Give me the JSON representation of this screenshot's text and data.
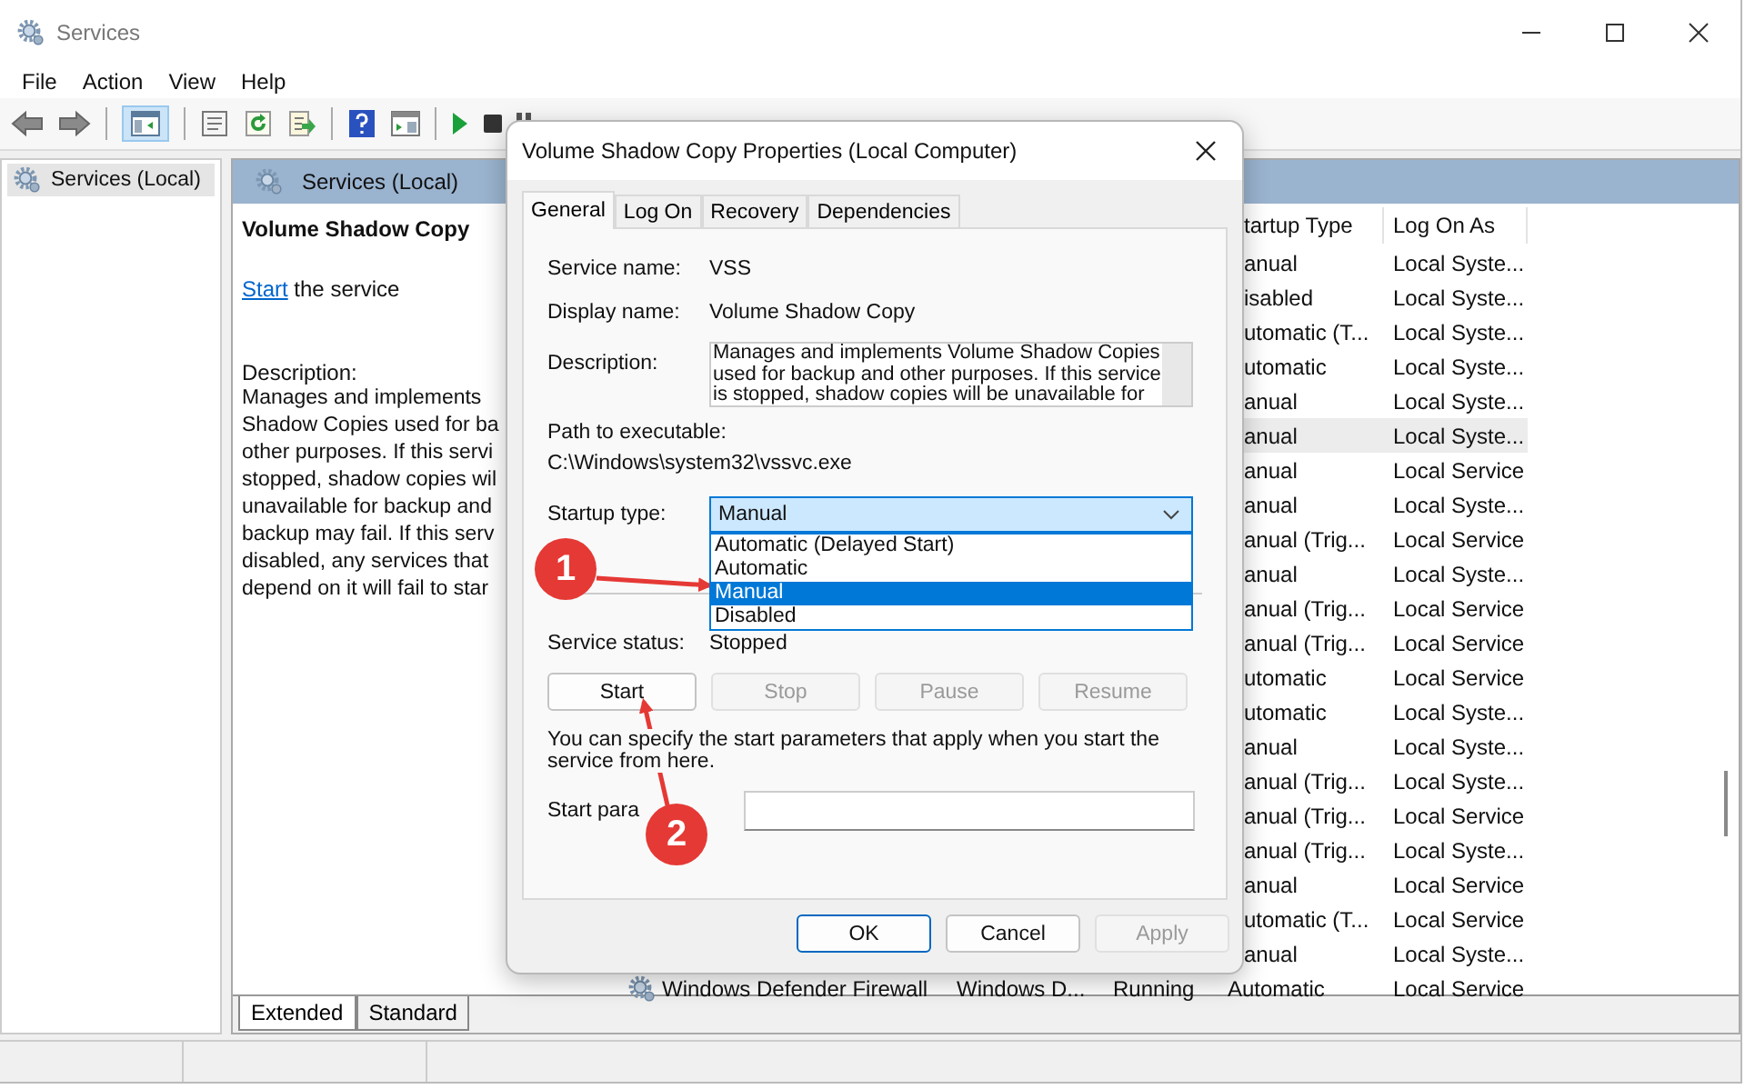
{
  "window": {
    "title": "Services"
  },
  "menu": [
    "File",
    "Action",
    "View",
    "Help"
  ],
  "toolbar": {
    "console_tree_pressed": true
  },
  "tree": [
    {
      "label": "Services (Local)",
      "selected": true
    }
  ],
  "pane": {
    "header": "Services (Local)",
    "service_title": "Volume Shadow Copy",
    "action_link": "Start",
    "action_rest": " the service",
    "description_label": "Description:",
    "description_lines": [
      "Manages and implements",
      "Shadow Copies used for ba",
      "other purposes. If this servi",
      "stopped, shadow copies wil",
      "unavailable for backup and",
      "backup may fail. If this serv",
      "disabled, any services that",
      "depend on it will fail to star"
    ]
  },
  "list": {
    "columns": [
      "tartup Type",
      "Log On As"
    ],
    "rows": [
      {
        "startup_type": "anual",
        "log_on_as": "Local Syste...",
        "selected": false
      },
      {
        "startup_type": "isabled",
        "log_on_as": "Local Syste...",
        "selected": false
      },
      {
        "startup_type": "utomatic (T...",
        "log_on_as": "Local Syste...",
        "selected": false
      },
      {
        "startup_type": "utomatic",
        "log_on_as": "Local Syste...",
        "selected": false
      },
      {
        "startup_type": "anual",
        "log_on_as": "Local Syste...",
        "selected": false
      },
      {
        "startup_type": "anual",
        "log_on_as": "Local Syste...",
        "selected": true
      },
      {
        "startup_type": "anual",
        "log_on_as": "Local Service",
        "selected": false
      },
      {
        "startup_type": "anual",
        "log_on_as": "Local Syste...",
        "selected": false
      },
      {
        "startup_type": "anual (Trig...",
        "log_on_as": "Local Service",
        "selected": false
      },
      {
        "startup_type": "anual",
        "log_on_as": "Local Syste...",
        "selected": false
      },
      {
        "startup_type": "anual (Trig...",
        "log_on_as": "Local Service",
        "selected": false
      },
      {
        "startup_type": "anual (Trig...",
        "log_on_as": "Local Service",
        "selected": false
      },
      {
        "startup_type": "utomatic",
        "log_on_as": "Local Service",
        "selected": false
      },
      {
        "startup_type": "utomatic",
        "log_on_as": "Local Syste...",
        "selected": false
      },
      {
        "startup_type": "anual",
        "log_on_as": "Local Syste...",
        "selected": false
      },
      {
        "startup_type": "anual (Trig...",
        "log_on_as": "Local Syste...",
        "selected": false
      },
      {
        "startup_type": "anual (Trig...",
        "log_on_as": "Local Service",
        "selected": false
      },
      {
        "startup_type": "anual (Trig...",
        "log_on_as": "Local Syste...",
        "selected": false
      },
      {
        "startup_type": "anual",
        "log_on_as": "Local Service",
        "selected": false
      },
      {
        "startup_type": "utomatic (T...",
        "log_on_as": "Local Service",
        "selected": false
      },
      {
        "startup_type": "anual",
        "log_on_as": "Local Syste...",
        "selected": false
      },
      {
        "name": "Windows Defender Firewall",
        "description": "Windows D...",
        "status": "Running",
        "startup_type": "Automatic",
        "log_on_as": "Local Service",
        "selected": false
      }
    ]
  },
  "view_tabs": [
    {
      "label": "Extended",
      "selected": true
    },
    {
      "label": "Standard",
      "selected": false
    }
  ],
  "dialog": {
    "title": "Volume Shadow Copy Properties (Local Computer)",
    "tabs": [
      {
        "label": "General",
        "selected": true
      },
      {
        "label": "Log On",
        "selected": false
      },
      {
        "label": "Recovery",
        "selected": false
      },
      {
        "label": "Dependencies",
        "selected": false
      }
    ],
    "fields": [
      {
        "label": "Service name:",
        "value": "VSS"
      },
      {
        "label": "Display name:",
        "value": "Volume Shadow Copy"
      }
    ],
    "description": {
      "label": "Description:",
      "lines": [
        "Manages and implements Volume Shadow Copies",
        "used for backup and other purposes. If this service",
        "is stopped, shadow copies will be unavailable for"
      ]
    },
    "path": {
      "label": "Path to executable:",
      "value": "C:\\Windows\\system32\\vssvc.exe"
    },
    "startup": {
      "label": "Startup type:",
      "value": "Manual",
      "expanded": true,
      "options": [
        {
          "label": "Automatic (Delayed Start)",
          "selected": false
        },
        {
          "label": "Automatic",
          "selected": false
        },
        {
          "label": "Manual",
          "selected": true
        },
        {
          "label": "Disabled",
          "selected": false
        }
      ]
    },
    "status": {
      "label": "Service status:",
      "value": "Stopped"
    },
    "service_buttons": [
      {
        "label": "Start",
        "disabled": false
      },
      {
        "label": "Stop",
        "disabled": true
      },
      {
        "label": "Pause",
        "disabled": true
      },
      {
        "label": "Resume",
        "disabled": true
      }
    ],
    "hint": "You can specify the start parameters that apply when you start the service from here.",
    "params": {
      "label": "Start para"
    },
    "buttons": [
      {
        "label": "OK",
        "default": true,
        "disabled": false
      },
      {
        "label": "Cancel",
        "default": false,
        "disabled": false
      },
      {
        "label": "Apply",
        "default": false,
        "disabled": true
      }
    ]
  },
  "annotations": [
    {
      "label": "1"
    },
    {
      "label": "2"
    }
  ]
}
